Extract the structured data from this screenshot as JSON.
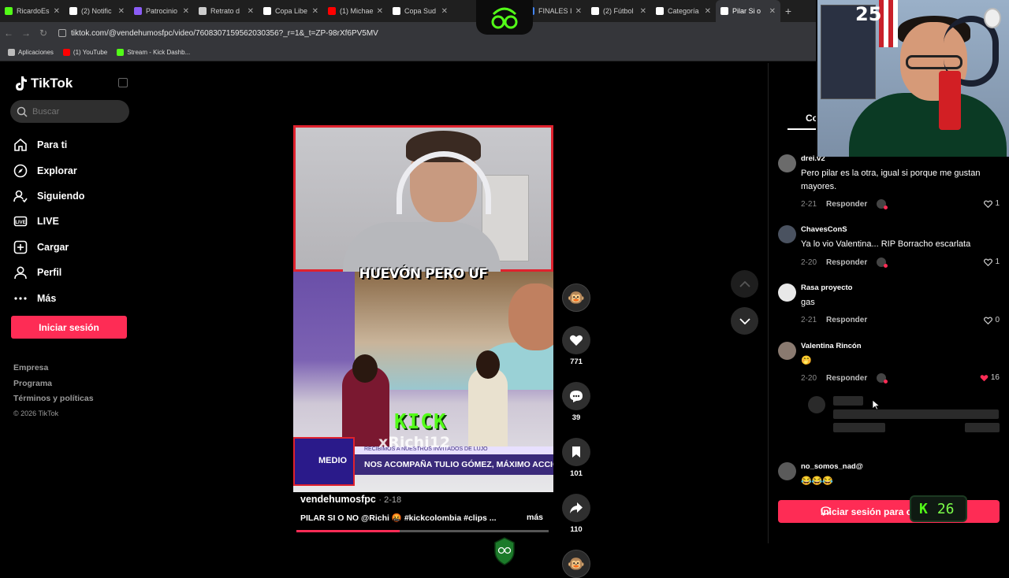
{
  "browser": {
    "tabs": [
      {
        "label": "RicardoEs",
        "color": "#53fc18"
      },
      {
        "label": "(2) Notific",
        "color": "#ffffff"
      },
      {
        "label": "Patrocinio",
        "color": "#8a5cf6"
      },
      {
        "label": "Retrato d",
        "color": "#cccccc"
      },
      {
        "label": "Copa Libe",
        "color": "#ffffff"
      },
      {
        "label": "(1) Michae",
        "color": "#ff0000"
      },
      {
        "label": "Copa Sud",
        "color": "#ffffff"
      },
      {
        "label": "FINALES I",
        "color": "#4285f4"
      },
      {
        "label": "(2) Fútbol",
        "color": "#ffffff"
      },
      {
        "label": "Categoría",
        "color": "#ffffff"
      },
      {
        "label": "Pilar Si o",
        "color": "#ffffff"
      }
    ],
    "url": "tiktok.com/@vendehumosfpc/video/7608307159562030356?_r=1&_t=ZP-98rXf6PV5MV",
    "bookmarks": [
      {
        "label": "Aplicaciones",
        "color": "#bbbbbb"
      },
      {
        "label": "(1) YouTube",
        "color": "#ff0000"
      },
      {
        "label": "Stream - Kick Dashb...",
        "color": "#53fc18"
      }
    ]
  },
  "sidebar": {
    "brand": "TikTok",
    "search_placeholder": "Buscar",
    "menu": [
      {
        "label": "Para ti",
        "icon": "home-icon"
      },
      {
        "label": "Explorar",
        "icon": "compass-icon"
      },
      {
        "label": "Siguiendo",
        "icon": "following-icon"
      },
      {
        "label": "LIVE",
        "icon": "live-icon"
      },
      {
        "label": "Cargar",
        "icon": "upload-icon"
      },
      {
        "label": "Perfil",
        "icon": "profile-icon"
      },
      {
        "label": "Más",
        "icon": "more-icon"
      }
    ],
    "login_button": "Iniciar sesión",
    "footer": {
      "company": "Empresa",
      "program": "Programa",
      "terms": "Términos y políticas",
      "copyright": "© 2026 TikTok"
    }
  },
  "video": {
    "caption_overlay": "HUEVÓN PERO UF",
    "kick_text": "KICK",
    "watermark": "xRichi12",
    "lower_third": "NOS ACOMPAÑA TULIO GÓMEZ, MÁXIMO ACCIONISTA",
    "lower_third_top": "RECIBIMOS A NUESTROS INVITADOS DE LUJO",
    "badge_text": "MEDIO",
    "author": "vendehumosfpc",
    "date": "2-18",
    "description": "PILAR SI O NO @Richi 🤬 #kickcolombia #clips ...",
    "more": "más",
    "progress": 0.41
  },
  "actions": {
    "likes": "771",
    "comments": "39",
    "saves": "101",
    "shares": "110"
  },
  "comments_panel": {
    "tab_label": "Co",
    "comments": [
      {
        "user": "drei.v2",
        "text": "Pero pilar es la otra, igual si porque me gustan mayores.",
        "date": "2-21",
        "reply": "Responder",
        "likes": "1",
        "liked": false,
        "avatar": "#6b6b6b"
      },
      {
        "user": "ChavesConS",
        "text": "Ya lo vio Valentina... RIP Borracho escarlata",
        "date": "2-20",
        "reply": "Responder",
        "likes": "1",
        "liked": false,
        "avatar": "#4a5260"
      },
      {
        "user": "Rasa proyecto",
        "text": "gas",
        "date": "2-21",
        "reply": "Responder",
        "likes": "0",
        "liked": false,
        "avatar": "#e8e8e8"
      },
      {
        "user": "Valentina Rincón",
        "text": "🤭",
        "date": "2-20",
        "reply": "Responder",
        "likes": "16",
        "liked": true,
        "avatar": "#8a7a70"
      },
      {
        "user": "no_somos_nad@",
        "text": "😂😂😂",
        "avatar": "#5a5a5a"
      }
    ],
    "login_button": "Iniciar sesión para comentar",
    "kick_count": "26"
  },
  "webcam": {
    "poster_number": "25"
  }
}
